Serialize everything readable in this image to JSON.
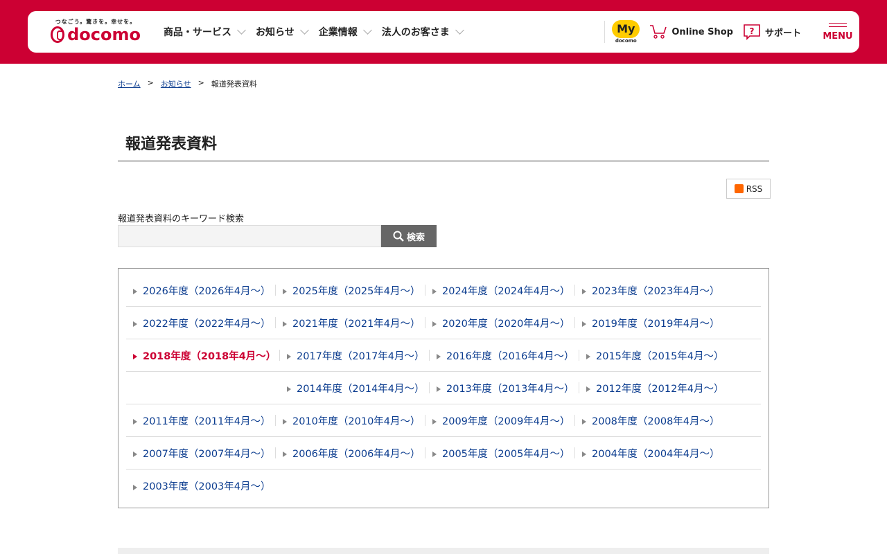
{
  "header": {
    "tagline": "つなごう。驚きを。幸せを。",
    "brand": "docomo",
    "nav": [
      "商品・サービス",
      "お知らせ",
      "企業情報",
      "法人のお客さま"
    ],
    "my": "My",
    "my_sub": "docomo",
    "online_shop": "Online Shop",
    "support": "サポート",
    "menu": "MENU"
  },
  "breadcrumb": [
    "ホーム",
    "お知らせ",
    "報道発表資料"
  ],
  "page_title": "報道発表資料",
  "rss": "RSS",
  "search": {
    "label": "報道発表資料のキーワード検索",
    "value": "",
    "button": "検索"
  },
  "years": [
    [
      "2026年度（2026年4月～）",
      "2025年度（2025年4月～）",
      "2024年度（2024年4月～）",
      "2023年度（2023年4月～）"
    ],
    [
      "2022年度（2022年4月～）",
      "2021年度（2021年4月～）",
      "2020年度（2020年4月～）",
      "2019年度（2019年4月～）"
    ],
    [
      "2018年度（2018年4月～）",
      "2017年度（2017年4月～）",
      "2016年度（2016年4月～）",
      "2015年度（2015年4月～）"
    ],
    [
      "2014年度（2014年4月～）",
      "2013年度（2013年4月～）",
      "2012年度（2012年4月～）"
    ],
    [
      "2011年度（2011年4月～）",
      "2010年度（2010年4月～）",
      "2009年度（2009年4月～）",
      "2008年度（2008年4月～）"
    ],
    [
      "2007年度（2007年4月～）",
      "2006年度（2006年4月～）",
      "2005年度（2005年4月～）",
      "2004年度（2004年4月～）"
    ],
    [
      "2003年度（2003年4月～）"
    ]
  ],
  "current_year": "2018年度（2018年4月～）"
}
